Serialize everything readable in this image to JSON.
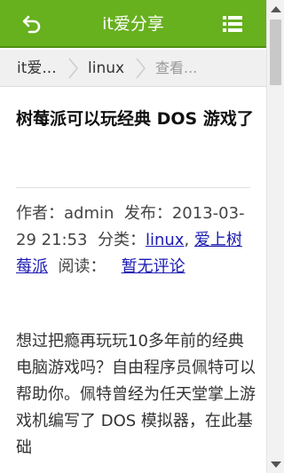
{
  "header": {
    "title": "it爱分享",
    "back_icon": "back-arrow-icon",
    "menu_icon": "list-menu-icon",
    "color": "#67b01e"
  },
  "breadcrumb": {
    "items": [
      "it爱...",
      "linux",
      "查看..."
    ],
    "separator_icon": "chevron-right-icon"
  },
  "article": {
    "title": "树莓派可以玩经典 DOS 游戏了",
    "meta": {
      "author_label": "作者：",
      "author": "admin",
      "published_label": "发布：",
      "published": "2013-03-29 21:53",
      "category_label": "分类：",
      "categories": [
        "linux",
        "爱上树莓派"
      ],
      "category_separator": ",",
      "read_label": "阅读：",
      "comments_link": "暂无评论",
      "link_color": "#1a1ab2"
    },
    "body": "想过把瘾再玩玩10多年前的经典电脑游戏吗？自由程序员佩特可以帮助你。佩特曾经为任天堂掌上游戏机编写了 DOS 模拟器，在此基础"
  }
}
